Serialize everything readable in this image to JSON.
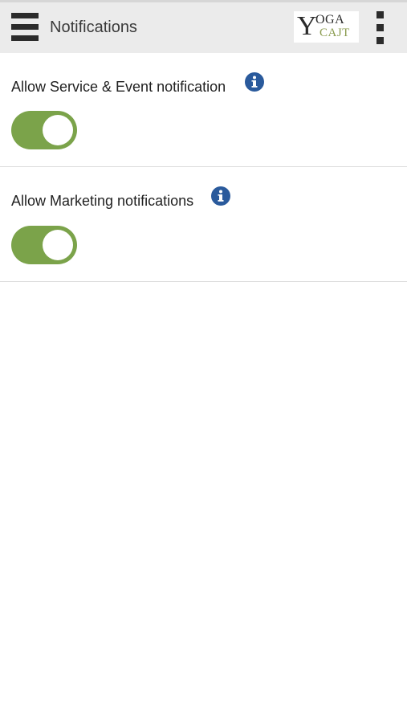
{
  "header": {
    "title": "Notifications",
    "menu_icon": "hamburger-menu-icon",
    "overflow_icon": "more-vertical-icon",
    "logo": {
      "line1_initial": "Y",
      "line1_rest": "OGA",
      "line2": "CAJT"
    }
  },
  "settings": [
    {
      "label": "Allow Service & Event notification",
      "info_icon": "info-icon",
      "enabled": true
    },
    {
      "label": "Allow Marketing notifications",
      "info_icon": "info-icon",
      "enabled": true
    }
  ],
  "colors": {
    "header_bg": "#ebebeb",
    "toggle_on": "#7ba34a",
    "info_icon": "#2a5a9c",
    "logo_accent": "#8a9b4e"
  }
}
